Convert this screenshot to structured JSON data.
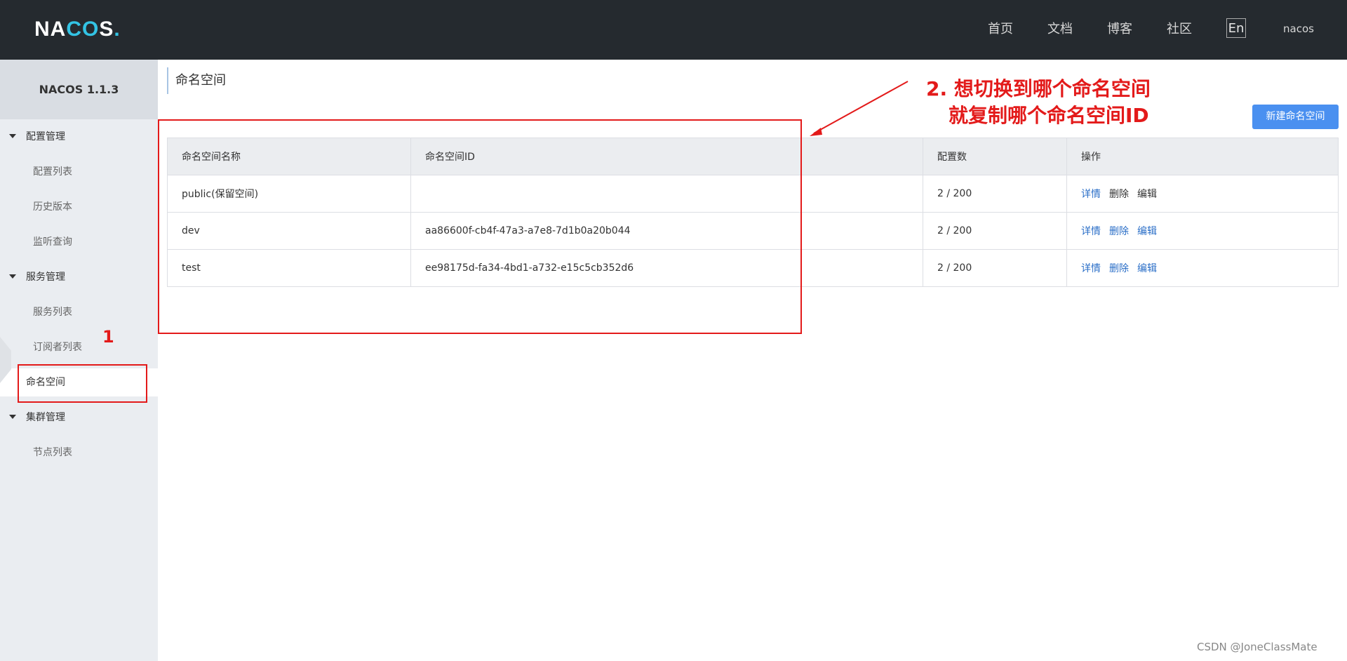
{
  "header": {
    "logo": {
      "prefix": "NA",
      "oo": "CO",
      "suffix": "S",
      "dot": "."
    },
    "nav": [
      "首页",
      "文档",
      "博客",
      "社区"
    ],
    "lang": "En",
    "user": "nacos"
  },
  "sidebar": {
    "title": "NACOS 1.1.3",
    "groups": [
      {
        "label": "配置管理",
        "items": [
          "配置列表",
          "历史版本",
          "监听查询"
        ]
      },
      {
        "label": "服务管理",
        "items": [
          "服务列表",
          "订阅者列表",
          "命名空间"
        ]
      },
      {
        "label": "集群管理",
        "items": [
          "节点列表"
        ]
      }
    ],
    "active": "命名空间"
  },
  "main": {
    "title": "命名空间",
    "new_button": "新建命名空间",
    "table": {
      "columns": [
        "命名空间名称",
        "命名空间ID",
        "配置数",
        "操作"
      ],
      "rows": [
        {
          "name": "public(保留空间)",
          "id": "",
          "count": "2 / 200"
        },
        {
          "name": "dev",
          "id": "aa86600f-cb4f-47a3-a7e8-7d1b0a20b044",
          "count": "2 / 200"
        },
        {
          "name": "test",
          "id": "ee98175d-fa34-4bd1-a732-e15c5cb352d6",
          "count": "2 / 200"
        }
      ],
      "ops": [
        "详情",
        "删除",
        "编辑"
      ]
    }
  },
  "annotations": {
    "step1": "1",
    "step2_line1": "2. 想切换到哪个命名空间",
    "step2_line2": "就复制哪个命名空间ID",
    "color": "#e31a1a"
  },
  "watermark": "CSDN @JoneClassMate"
}
